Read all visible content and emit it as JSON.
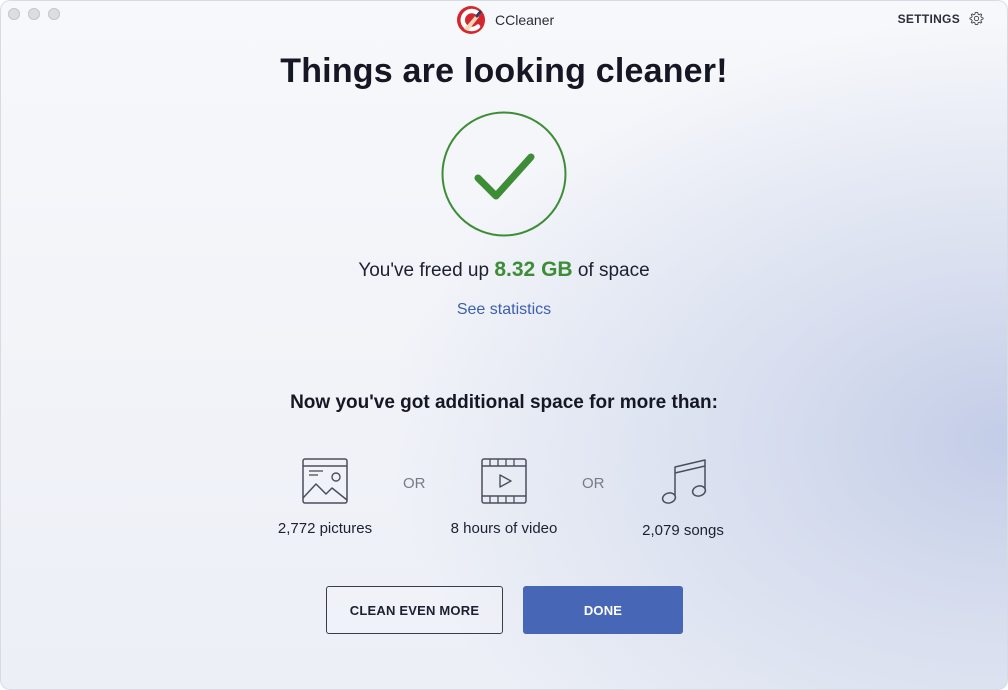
{
  "titlebar": {
    "app_name": "CCleaner",
    "settings_label": "SETTINGS"
  },
  "headline": "Things are looking cleaner!",
  "freed": {
    "prefix": "You've freed up",
    "amount": "8.32 GB",
    "suffix": "of space"
  },
  "stats_link": "See statistics",
  "subhead": "Now you've got additional space for more than:",
  "equivalents": [
    {
      "label": "2,772 pictures",
      "icon": "picture-icon"
    },
    {
      "label": "8 hours of video",
      "icon": "video-icon"
    },
    {
      "label": "2,079 songs",
      "icon": "music-note-icon"
    }
  ],
  "separator": "OR",
  "buttons": {
    "secondary": "CLEAN EVEN MORE",
    "primary": "DONE"
  },
  "colors": {
    "accent_green": "#3d8d36",
    "link_blue": "#3c5fae",
    "primary_button": "#4766b6",
    "logo_red": "#d6262d"
  }
}
